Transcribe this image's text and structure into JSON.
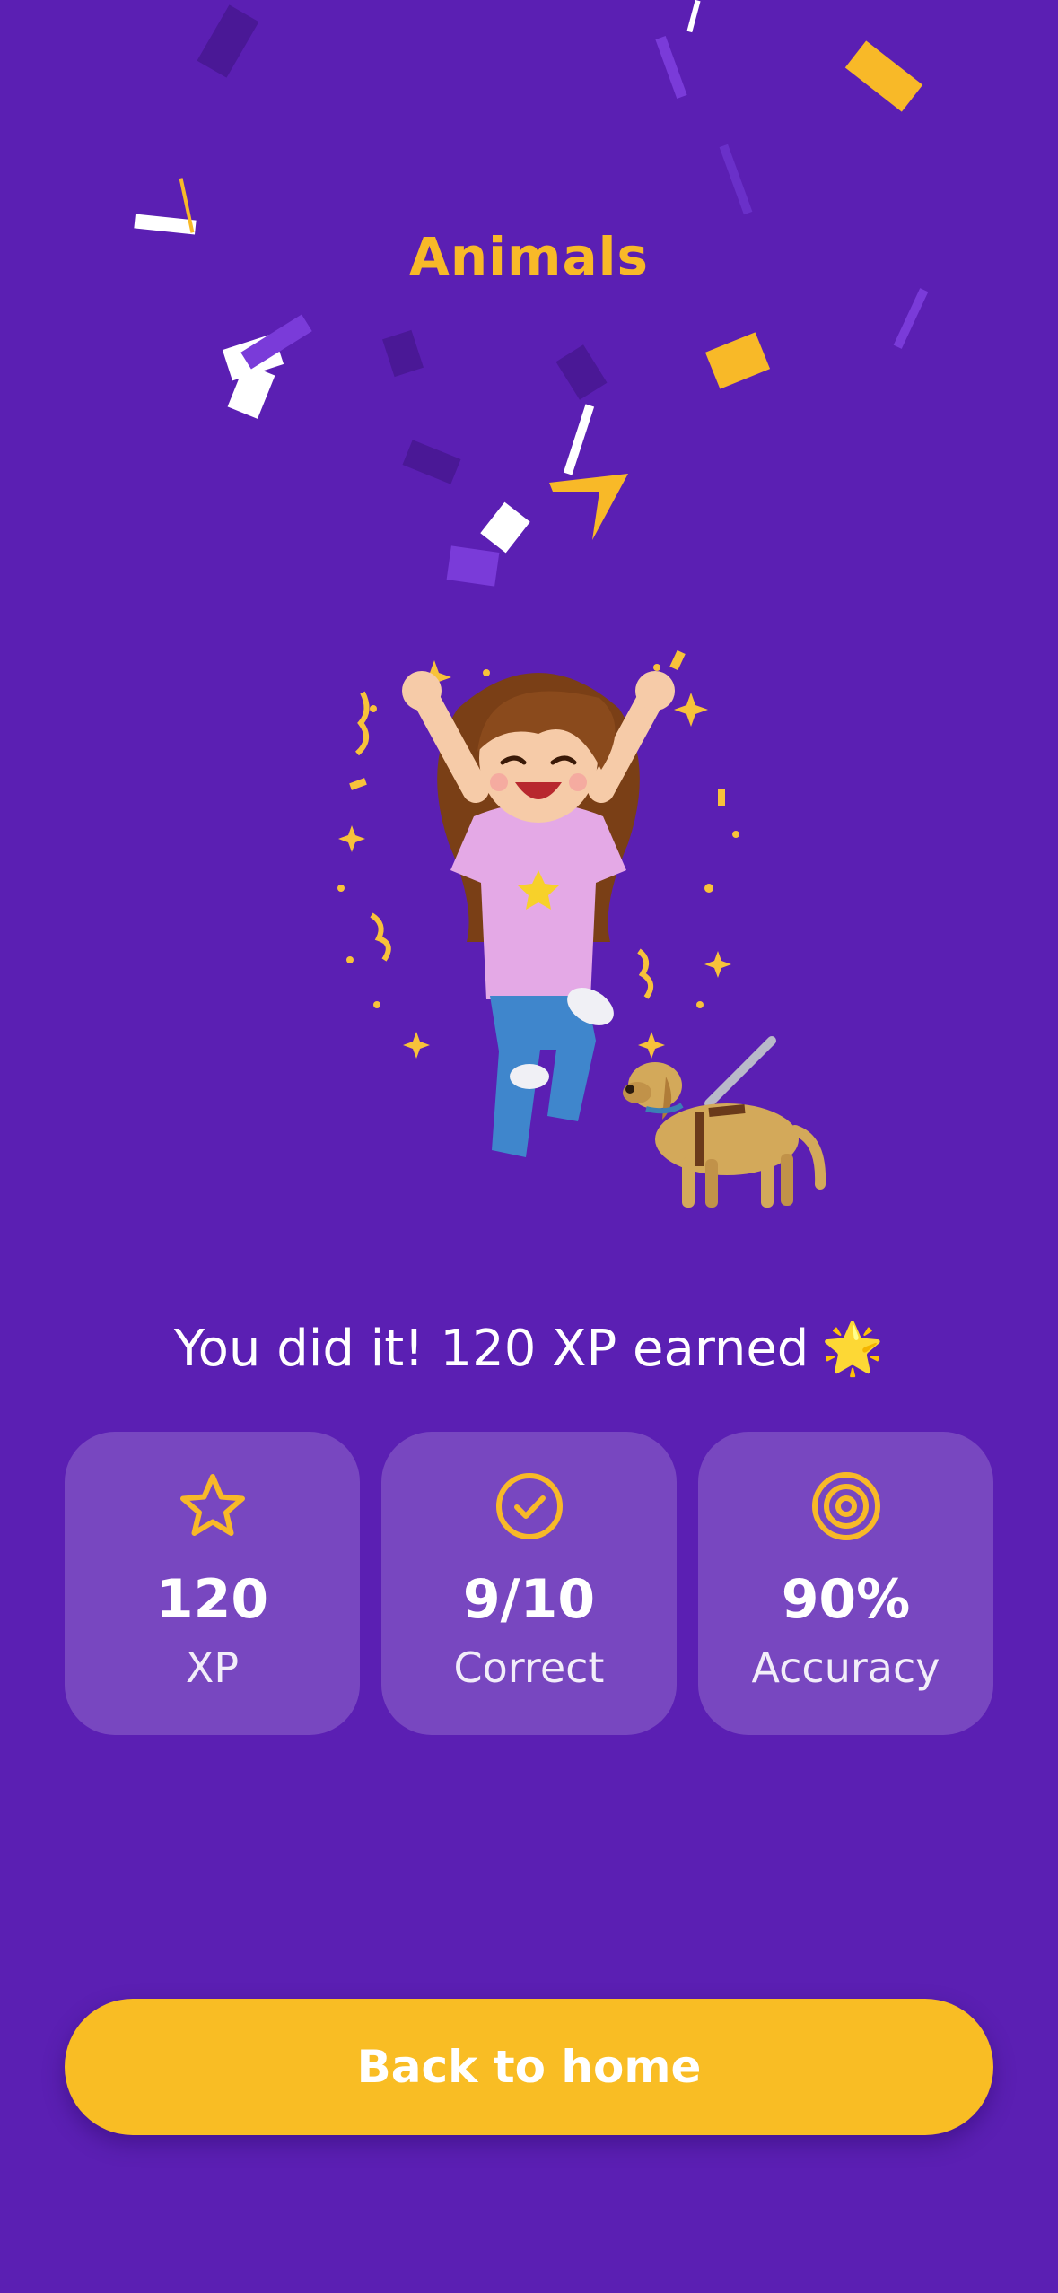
{
  "header": {
    "title": "Animals"
  },
  "result": {
    "message": "You did it! 120 XP earned",
    "message_emoji": "🌟"
  },
  "stats": [
    {
      "icon": "star-icon",
      "value": "120",
      "label": "XP"
    },
    {
      "icon": "check-circle-icon",
      "value": "9/10",
      "label": "Correct"
    },
    {
      "icon": "target-icon",
      "value": "90%",
      "label": "Accuracy"
    }
  ],
  "actions": {
    "back_home_label": "Back to home"
  },
  "colors": {
    "background": "#5b1fb3",
    "accent": "#f8b928",
    "card": "rgba(255,255,255,0.18)"
  }
}
